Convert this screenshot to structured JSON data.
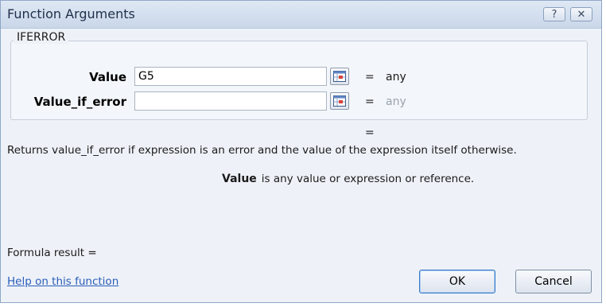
{
  "window": {
    "title": "Function Arguments",
    "help_glyph": "?",
    "close_glyph": "✕"
  },
  "function": {
    "name": "IFERROR",
    "args": [
      {
        "label": "Value",
        "input_value": "G5",
        "equals": "=",
        "result": "any"
      },
      {
        "label": "Value_if_error",
        "input_value": "",
        "equals": "=",
        "result": "any"
      }
    ],
    "result_equals": "="
  },
  "description": "Returns value_if_error if expression is an error and the value of the expression itself otherwise.",
  "arg_help": {
    "name": "Value",
    "text": "is any value or expression or reference."
  },
  "formula_result_label": "Formula result =",
  "help_link": "Help on this function",
  "buttons": {
    "ok": "OK",
    "cancel": "Cancel"
  },
  "colors": {
    "title_bg": "#c9d7ea",
    "dialog_bg": "#eef2f8",
    "link": "#2a5cb8",
    "muted": "#9aa3ad"
  }
}
